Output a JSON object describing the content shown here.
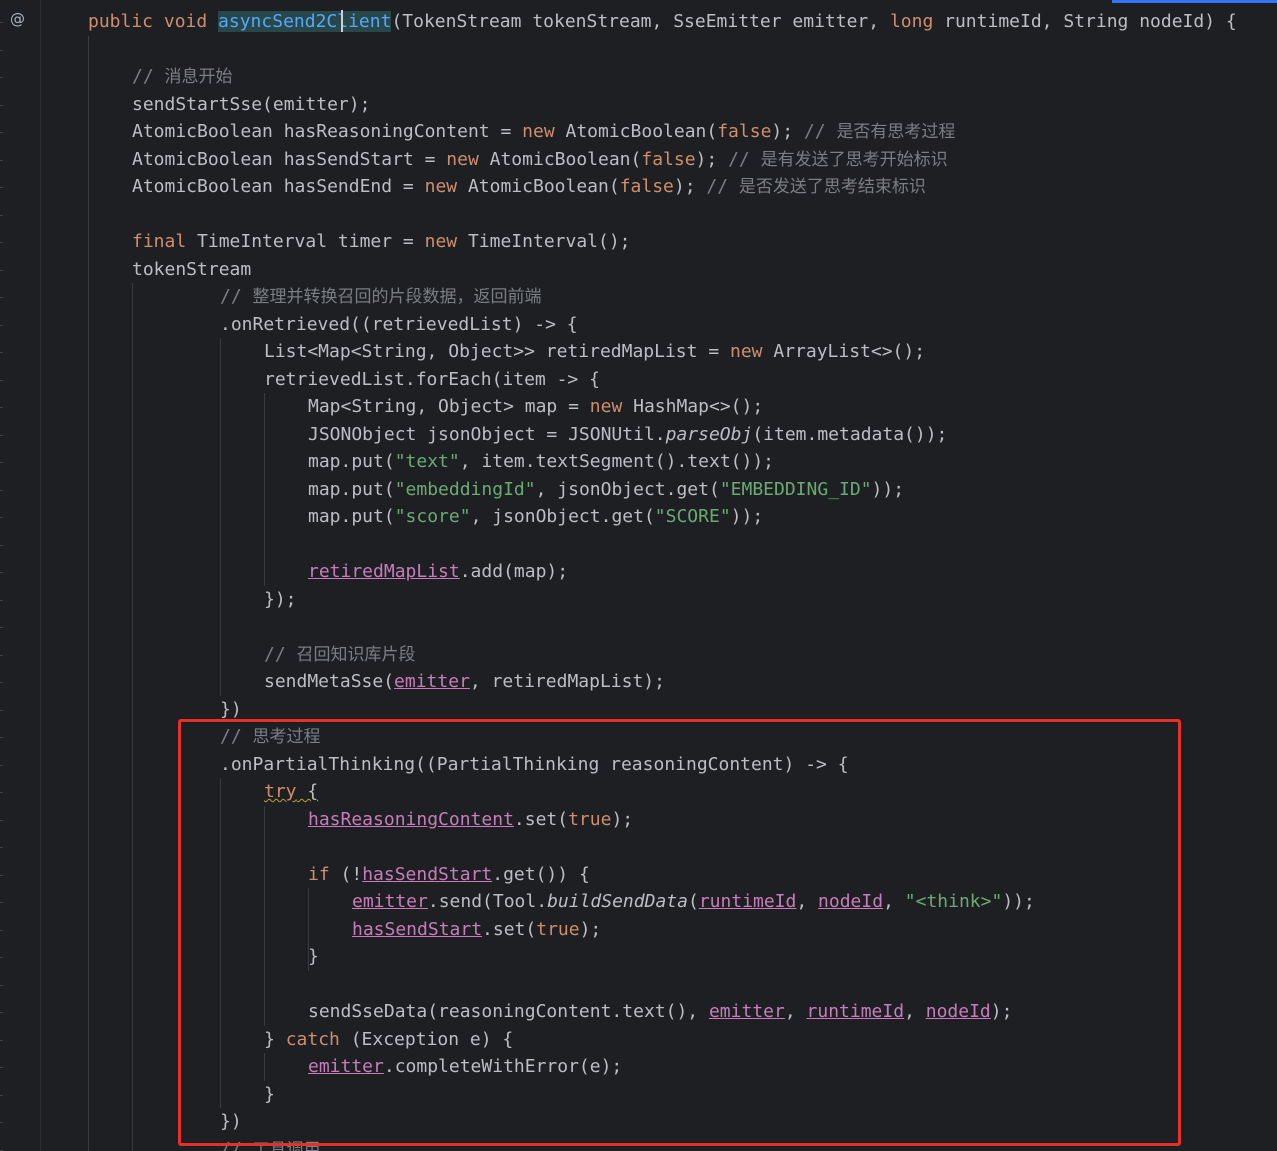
{
  "gutter": {
    "override_marker": "@"
  },
  "colors": {
    "background": "#1e1f22",
    "keyword": "#cf8e6d",
    "string": "#6aab73",
    "comment": "#7a7e85",
    "field": "#c77dbb",
    "method_declaration": "#56a8f5",
    "highlight_border": "#e8302a"
  },
  "code_lines": [
    {
      "tokens": [
        [
          "kw",
          "public void "
        ],
        [
          "fn-decl",
          "asyncSend2Client"
        ],
        [
          "",
          "(TokenStream tokenStream, SseEmitter emitter, "
        ],
        [
          "kw",
          "long"
        ],
        [
          "",
          " runtimeId, String nodeId) {"
        ]
      ]
    },
    {
      "tokens": []
    },
    {
      "tokens": [
        [
          "cmt",
          "// "
        ],
        [
          "cmt-cjk",
          "消息开始"
        ]
      ]
    },
    {
      "tokens": [
        [
          "",
          "sendStartSse(emitter);"
        ]
      ]
    },
    {
      "tokens": [
        [
          "",
          "AtomicBoolean hasReasoningContent = "
        ],
        [
          "kw",
          "new"
        ],
        [
          "",
          " AtomicBoolean("
        ],
        [
          "kw",
          "false"
        ],
        [
          "",
          "); "
        ],
        [
          "cmt",
          "// "
        ],
        [
          "cmt-cjk",
          "是否有思考过程"
        ]
      ]
    },
    {
      "tokens": [
        [
          "",
          "AtomicBoolean hasSendStart = "
        ],
        [
          "kw",
          "new"
        ],
        [
          "",
          " AtomicBoolean("
        ],
        [
          "kw",
          "false"
        ],
        [
          "",
          "); "
        ],
        [
          "cmt",
          "// "
        ],
        [
          "cmt-cjk",
          "是有发送了思考开始标识"
        ]
      ]
    },
    {
      "tokens": [
        [
          "",
          "AtomicBoolean hasSendEnd = "
        ],
        [
          "kw",
          "new"
        ],
        [
          "",
          " AtomicBoolean("
        ],
        [
          "kw",
          "false"
        ],
        [
          "",
          "); "
        ],
        [
          "cmt",
          "// "
        ],
        [
          "cmt-cjk",
          "是否发送了思考结束标识"
        ]
      ]
    },
    {
      "tokens": []
    },
    {
      "tokens": [
        [
          "kw",
          "final"
        ],
        [
          "",
          " TimeInterval timer = "
        ],
        [
          "kw",
          "new"
        ],
        [
          "",
          " TimeInterval();"
        ]
      ]
    },
    {
      "tokens": [
        [
          "",
          "tokenStream"
        ]
      ]
    },
    {
      "tokens": [
        [
          "cmt",
          "// "
        ],
        [
          "cmt-cjk",
          "整理并转换召回的片段数据，返回前端"
        ]
      ]
    },
    {
      "tokens": [
        [
          "",
          ".onRetrieved((retrievedList) -> {"
        ]
      ]
    },
    {
      "tokens": [
        [
          "",
          "List<Map<String, Object>> retiredMapList = "
        ],
        [
          "kw",
          "new"
        ],
        [
          "",
          " ArrayList<>();"
        ]
      ]
    },
    {
      "tokens": [
        [
          "",
          "retrievedList.forEach(item -> {"
        ]
      ]
    },
    {
      "tokens": [
        [
          "",
          "Map<String, Object> map = "
        ],
        [
          "kw",
          "new"
        ],
        [
          "",
          " HashMap<>();"
        ]
      ]
    },
    {
      "tokens": [
        [
          "",
          "JSONObject jsonObject = JSONUtil."
        ],
        [
          "ital",
          "parseObj"
        ],
        [
          "",
          "(item.metadata());"
        ]
      ]
    },
    {
      "tokens": [
        [
          "",
          "map.put("
        ],
        [
          "str",
          "\"text\""
        ],
        [
          "",
          ", item.textSegment().text());"
        ]
      ]
    },
    {
      "tokens": [
        [
          "",
          "map.put("
        ],
        [
          "str",
          "\"embeddingId\""
        ],
        [
          "",
          ", jsonObject.get("
        ],
        [
          "str",
          "\"EMBEDDING_ID\""
        ],
        [
          "",
          "));"
        ]
      ]
    },
    {
      "tokens": [
        [
          "",
          "map.put("
        ],
        [
          "str",
          "\"score\""
        ],
        [
          "",
          ", jsonObject.get("
        ],
        [
          "str",
          "\"SCORE\""
        ],
        [
          "",
          "));"
        ]
      ]
    },
    {
      "tokens": []
    },
    {
      "tokens": [
        [
          "fld",
          "retiredMapList"
        ],
        [
          "",
          ".add(map);"
        ]
      ]
    },
    {
      "tokens": [
        [
          "",
          "});"
        ]
      ]
    },
    {
      "tokens": []
    },
    {
      "tokens": [
        [
          "cmt",
          "// "
        ],
        [
          "cmt-cjk",
          "召回知识库片段"
        ]
      ]
    },
    {
      "tokens": [
        [
          "",
          "sendMetaSse("
        ],
        [
          "fld",
          "emitter"
        ],
        [
          "",
          ", retiredMapList);"
        ]
      ]
    },
    {
      "tokens": [
        [
          "",
          "})"
        ]
      ]
    },
    {
      "tokens": [
        [
          "cmt",
          "// "
        ],
        [
          "cmt-cjk",
          "思考过程"
        ]
      ]
    },
    {
      "tokens": [
        [
          "",
          ".onPartialThinking((PartialThinking reasoningContent) -> {"
        ]
      ]
    },
    {
      "tokens": [
        [
          "kw warn",
          "try"
        ],
        [
          "warn",
          " {"
        ]
      ]
    },
    {
      "tokens": [
        [
          "fld",
          "hasReasoningContent"
        ],
        [
          "",
          ".set("
        ],
        [
          "kw",
          "true"
        ],
        [
          "",
          ");"
        ]
      ]
    },
    {
      "tokens": []
    },
    {
      "tokens": [
        [
          "kw",
          "if"
        ],
        [
          "",
          " (!"
        ],
        [
          "fld",
          "hasSendStart"
        ],
        [
          "",
          ".get()) {"
        ]
      ]
    },
    {
      "tokens": [
        [
          "fld",
          "emitter"
        ],
        [
          "",
          ".send(Tool."
        ],
        [
          "ital",
          "buildSendData"
        ],
        [
          "",
          "("
        ],
        [
          "fld",
          "runtimeId"
        ],
        [
          "",
          ", "
        ],
        [
          "fld",
          "nodeId"
        ],
        [
          "",
          ", "
        ],
        [
          "str",
          "\"<think>\""
        ],
        [
          "",
          "));"
        ]
      ]
    },
    {
      "tokens": [
        [
          "fld",
          "hasSendStart"
        ],
        [
          "",
          ".set("
        ],
        [
          "kw",
          "true"
        ],
        [
          "",
          ");"
        ]
      ]
    },
    {
      "tokens": [
        [
          "",
          "}"
        ]
      ]
    },
    {
      "tokens": []
    },
    {
      "tokens": [
        [
          "",
          "sendSseData(reasoningContent.text(), "
        ],
        [
          "fld",
          "emitter"
        ],
        [
          "",
          ", "
        ],
        [
          "fld",
          "runtimeId"
        ],
        [
          "",
          ", "
        ],
        [
          "fld",
          "nodeId"
        ],
        [
          "",
          ");"
        ]
      ]
    },
    {
      "tokens": [
        [
          "",
          "} "
        ],
        [
          "kw",
          "catch"
        ],
        [
          "",
          " (Exception e) {"
        ]
      ]
    },
    {
      "tokens": [
        [
          "fld",
          "emitter"
        ],
        [
          "",
          ".completeWithError(e);"
        ]
      ]
    },
    {
      "tokens": [
        [
          "",
          "}"
        ]
      ]
    },
    {
      "tokens": [
        [
          "",
          "})"
        ]
      ]
    },
    {
      "tokens": [
        [
          "cmt",
          "// "
        ],
        [
          "cmt-cjk",
          "工具调用"
        ]
      ]
    }
  ]
}
